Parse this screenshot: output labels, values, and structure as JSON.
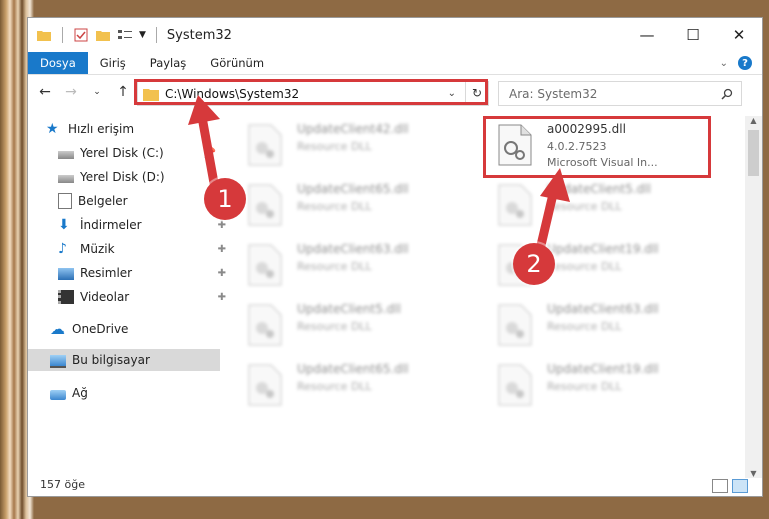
{
  "window": {
    "title": "System32"
  },
  "ribbon": {
    "tabs": [
      "Dosya",
      "Giriş",
      "Paylaş",
      "Görünüm"
    ],
    "help": "?"
  },
  "address": {
    "path": "C:\\Windows\\System32"
  },
  "search": {
    "placeholder": "Ara: System32"
  },
  "nav": {
    "items": [
      {
        "label": "Hızlı erişim",
        "icon": "star-icon"
      },
      {
        "label": "Yerel Disk (C:)",
        "icon": "drive-icon"
      },
      {
        "label": "Yerel Disk (D:)",
        "icon": "drive-icon"
      },
      {
        "label": "Belgeler",
        "icon": "documents-icon"
      },
      {
        "label": "İndirmeler",
        "icon": "download-icon"
      },
      {
        "label": "Müzik",
        "icon": "music-icon"
      },
      {
        "label": "Resimler",
        "icon": "pictures-icon"
      },
      {
        "label": "Videolar",
        "icon": "videos-icon"
      },
      {
        "label": "OneDrive",
        "icon": "cloud-icon"
      },
      {
        "label": "Bu bilgisayar",
        "icon": "computer-icon"
      },
      {
        "label": "Ağ",
        "icon": "network-icon"
      }
    ]
  },
  "files": {
    "left": [
      {
        "name": "UpdateClient42.dll",
        "desc": "Resource DLL"
      },
      {
        "name": "UpdateClient65.dll",
        "desc": "Resource DLL"
      },
      {
        "name": "UpdateClient63.dll",
        "desc": "Resource DLL"
      },
      {
        "name": "UpdateClient5.dll",
        "desc": "Resource DLL"
      },
      {
        "name": "UpdateClient65.dll",
        "desc": "Resource DLL"
      }
    ],
    "right": [
      {
        "name": "a0002995.dll",
        "desc": "4.0.2.7523",
        "desc2": "Microsoft Visual In..."
      },
      {
        "name": "UpdateClient5.dll",
        "desc": "Resource DLL"
      },
      {
        "name": "UpdateClient19.dll",
        "desc": "Resource DLL"
      },
      {
        "name": "UpdateClient63.dll",
        "desc": "Resource DLL"
      },
      {
        "name": "UpdateClient19.dll",
        "desc": "Resource DLL"
      }
    ]
  },
  "status": {
    "count": "157 öğe"
  },
  "callouts": [
    "1",
    "2"
  ]
}
